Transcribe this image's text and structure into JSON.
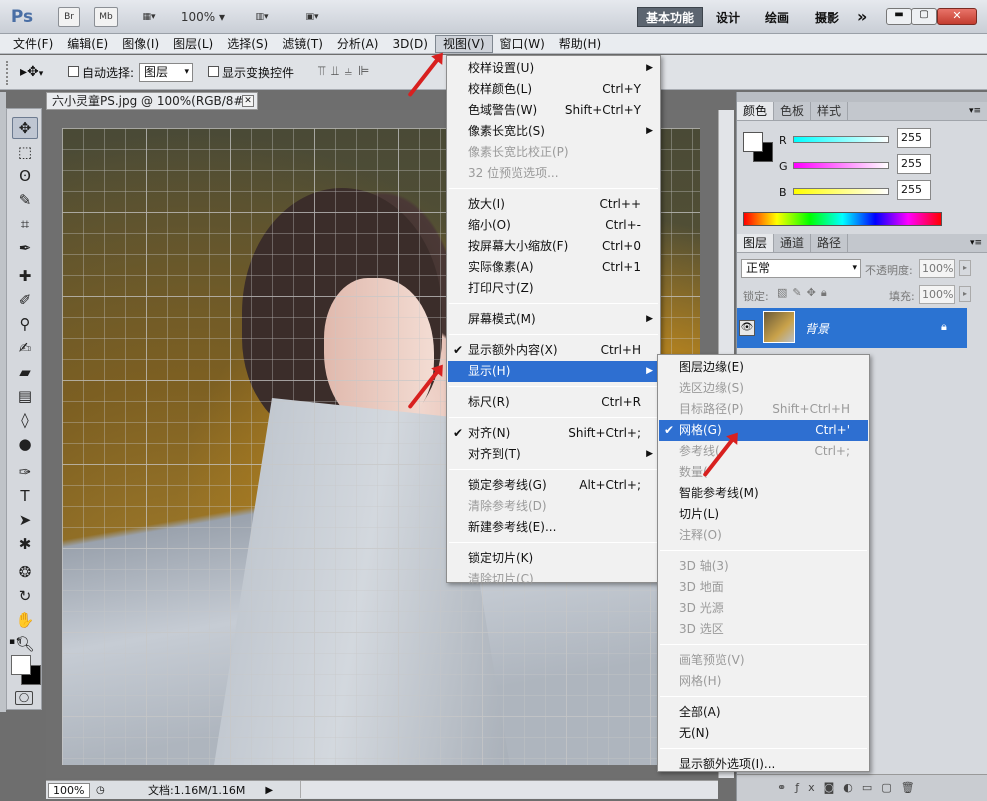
{
  "titlebar": {
    "logo": "Ps",
    "br": "Br",
    "mb": "Mb",
    "zoom": "100%",
    "workspaces": [
      "基本功能",
      "设计",
      "绘画",
      "摄影"
    ],
    "more": "»"
  },
  "menubar": [
    "文件(F)",
    "编辑(E)",
    "图像(I)",
    "图层(L)",
    "选择(S)",
    "滤镜(T)",
    "分析(A)",
    "3D(D)",
    "视图(V)",
    "窗口(W)",
    "帮助(H)"
  ],
  "options": {
    "auto_select": "自动选择:",
    "layer_select": "图层",
    "show_transform": "显示变换控件"
  },
  "document": {
    "tab": "六小灵童PS.jpg @ 100%(RGB/8#)",
    "zoom": "100%",
    "doc_info": "文档:1.16M/1.16M"
  },
  "view_menu": {
    "items": [
      {
        "label": "校样设置(U)",
        "shortcut": "",
        "sub": true
      },
      {
        "label": "校样颜色(L)",
        "shortcut": "Ctrl+Y"
      },
      {
        "label": "色域警告(W)",
        "shortcut": "Shift+Ctrl+Y"
      },
      {
        "label": "像素长宽比(S)",
        "shortcut": "",
        "sub": true
      },
      {
        "label": "像素长宽比校正(P)",
        "shortcut": "",
        "dis": true
      },
      {
        "label": "32 位预览选项...",
        "shortcut": "",
        "dis": true
      },
      {
        "label": "放大(I)",
        "shortcut": "Ctrl++",
        "sep": true
      },
      {
        "label": "缩小(O)",
        "shortcut": "Ctrl+-"
      },
      {
        "label": "按屏幕大小缩放(F)",
        "shortcut": "Ctrl+0"
      },
      {
        "label": "实际像素(A)",
        "shortcut": "Ctrl+1"
      },
      {
        "label": "打印尺寸(Z)",
        "shortcut": ""
      },
      {
        "label": "屏幕模式(M)",
        "shortcut": "",
        "sub": true,
        "sep": true
      },
      {
        "label": "显示额外内容(X)",
        "shortcut": "Ctrl+H",
        "check": true,
        "sep": true
      },
      {
        "label": "显示(H)",
        "shortcut": "",
        "sub": true,
        "hl": true
      },
      {
        "label": "标尺(R)",
        "shortcut": "Ctrl+R",
        "sep": true
      },
      {
        "label": "对齐(N)",
        "shortcut": "Shift+Ctrl+;",
        "check": true,
        "sep": true
      },
      {
        "label": "对齐到(T)",
        "shortcut": "",
        "sub": true
      },
      {
        "label": "锁定参考线(G)",
        "shortcut": "Alt+Ctrl+;",
        "sep": true
      },
      {
        "label": "清除参考线(D)",
        "shortcut": "",
        "dis": true
      },
      {
        "label": "新建参考线(E)...",
        "shortcut": ""
      },
      {
        "label": "锁定切片(K)",
        "shortcut": "",
        "sep": true
      },
      {
        "label": "清除切片(C)",
        "shortcut": "",
        "dis": true
      }
    ]
  },
  "show_menu": {
    "items": [
      {
        "label": "图层边缘(E)",
        "shortcut": ""
      },
      {
        "label": "选区边缘(S)",
        "shortcut": "",
        "dis": true
      },
      {
        "label": "目标路径(P)",
        "shortcut": "Shift+Ctrl+H",
        "dis": true
      },
      {
        "label": "网格(G)",
        "shortcut": "Ctrl+'",
        "check": true,
        "hl": true
      },
      {
        "label": "参考线(",
        "shortcut": "Ctrl+;",
        "dis": true
      },
      {
        "label": "数量(",
        "shortcut": "",
        "dis": true
      },
      {
        "label": "智能参考线(M)",
        "shortcut": ""
      },
      {
        "label": "切片(L)",
        "shortcut": ""
      },
      {
        "label": "注释(O)",
        "shortcut": "",
        "dis": true
      },
      {
        "label": "3D 轴(3)",
        "shortcut": "",
        "dis": true,
        "sep": true
      },
      {
        "label": "3D 地面",
        "shortcut": "",
        "dis": true
      },
      {
        "label": "3D 光源",
        "shortcut": "",
        "dis": true
      },
      {
        "label": "3D 选区",
        "shortcut": "",
        "dis": true
      },
      {
        "label": "画笔预览(V)",
        "shortcut": "",
        "dis": true,
        "sep": true
      },
      {
        "label": "网格(H)",
        "shortcut": "",
        "dis": true
      },
      {
        "label": "全部(A)",
        "shortcut": "",
        "sep": true
      },
      {
        "label": "无(N)",
        "shortcut": ""
      },
      {
        "label": "显示额外选项(I)...",
        "shortcut": "",
        "sep": true
      }
    ]
  },
  "color_panel": {
    "tabs": [
      "颜色",
      "色板",
      "样式"
    ],
    "channels": [
      {
        "name": "R",
        "value": "255"
      },
      {
        "name": "G",
        "value": "255"
      },
      {
        "name": "B",
        "value": "255"
      }
    ]
  },
  "layers_panel": {
    "tabs": [
      "图层",
      "通道",
      "路径"
    ],
    "blend_mode": "正常",
    "opacity_label": "不透明度:",
    "opacity": "100%",
    "lock_label": "锁定:",
    "fill_label": "填充:",
    "fill": "100%",
    "layer_name": "背景"
  }
}
